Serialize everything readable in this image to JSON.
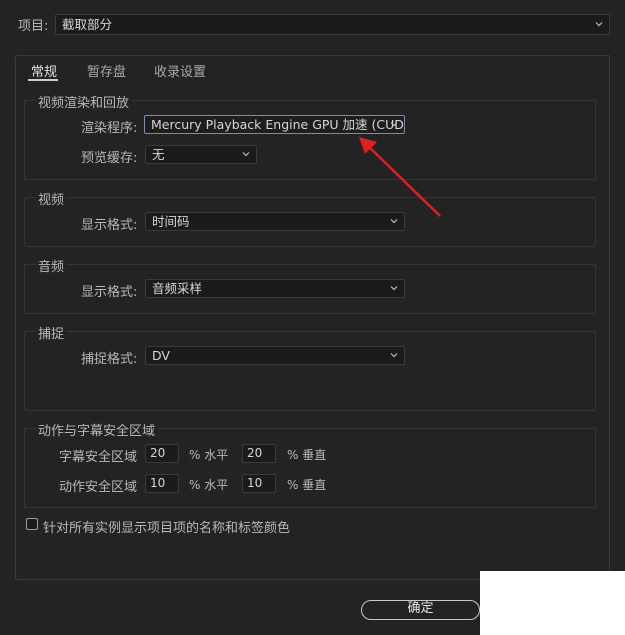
{
  "header": {
    "project_label": "项目:",
    "project_value": "截取部分"
  },
  "tabs": [
    "常规",
    "暂存盘",
    "收录设置"
  ],
  "render": {
    "title": "视频渲染和回放",
    "renderer_label": "渲染程序:",
    "renderer_value": "Mercury Playback Engine GPU 加速 (CUDA)",
    "preview_cache_label": "预览缓存:",
    "preview_cache_value": "无"
  },
  "video": {
    "title": "视频",
    "display_format_label": "显示格式:",
    "display_format_value": "时间码"
  },
  "audio": {
    "title": "音频",
    "display_format_label": "显示格式:",
    "display_format_value": "音频采样"
  },
  "capture": {
    "title": "捕捉",
    "capture_format_label": "捕捉格式:",
    "capture_format_value": "DV"
  },
  "safe_areas": {
    "title": "动作与字幕安全区域",
    "rows": [
      {
        "label": "字幕安全区域",
        "h_value": "20",
        "h_unit": "% 水平",
        "v_value": "20",
        "v_unit": "% 垂直"
      },
      {
        "label": "动作安全区域",
        "h_value": "10",
        "h_unit": "% 水平",
        "v_value": "10",
        "v_unit": "% 垂直"
      }
    ]
  },
  "checkbox": {
    "label": "针对所有实例显示项目项的名称和标签颜色",
    "checked": false
  },
  "footer": {
    "ok_label": "确定"
  },
  "colors": {
    "background": "#232323",
    "focus_border": "#6b8fc9",
    "annotation_arrow": "#e02020"
  }
}
